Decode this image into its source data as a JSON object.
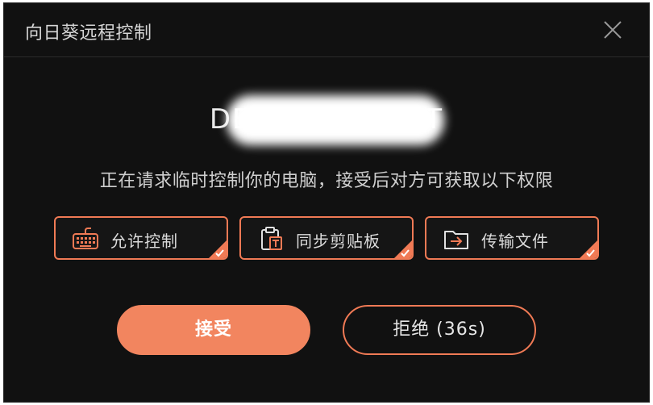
{
  "window": {
    "title": "向日葵远程控制"
  },
  "request": {
    "device_name": "DES               T",
    "message": "正在请求临时控制你的电脑，接受后对方可获取以下权限"
  },
  "permissions": [
    {
      "label": "允许控制",
      "icon": "keyboard-icon",
      "checked": true
    },
    {
      "label": "同步剪贴板",
      "icon": "clipboard-icon",
      "checked": true
    },
    {
      "label": "传输文件",
      "icon": "folder-transfer-icon",
      "checked": true
    }
  ],
  "actions": {
    "accept_label": "接受",
    "reject_label": "拒绝 (36s)"
  },
  "colors": {
    "accent": "#f2855f",
    "background": "#111111"
  }
}
